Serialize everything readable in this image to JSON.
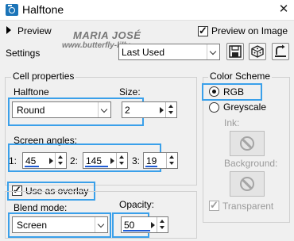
{
  "window": {
    "title": "Halftone",
    "close_glyph": "✕"
  },
  "top": {
    "preview_label": "Preview",
    "settings_label": "Settings",
    "watermark_name": "MARIA JOSÉ",
    "watermark_url": "www.butterfly-lilly",
    "preview_on_image_label": "Preview on Image",
    "preview_on_image_checked": true,
    "preset_value": "Last Used"
  },
  "cell": {
    "group_title": "Cell properties",
    "halftone_label": "Halftone",
    "halftone_value": "Round",
    "size_label": "Size:",
    "size_value": "2"
  },
  "angles": {
    "label": "Screen angles:",
    "items": [
      {
        "index_label": "1:",
        "value": "45",
        "level": 0.12
      },
      {
        "index_label": "2:",
        "value": "145",
        "level": 0.4
      },
      {
        "index_label": "3:",
        "value": "19",
        "level": 0.05
      }
    ]
  },
  "overlay": {
    "label": "Use as overlay",
    "checked": true
  },
  "blend": {
    "mode_label": "Blend mode:",
    "mode_value": "Screen",
    "opacity_label": "Opacity:",
    "opacity_value": "50",
    "opacity_level": 0.5
  },
  "scheme": {
    "group_title": "Color Scheme",
    "rgb_label": "RGB",
    "greyscale_label": "Greyscale",
    "ink_label": "Ink:",
    "background_label": "Background:",
    "transparent_label": "Transparent",
    "transparent_checked": true
  },
  "colors": {
    "highlight": "#3aa0ea",
    "slider_fill": "#1f5bd6",
    "app_icon": "#1b74b8"
  }
}
